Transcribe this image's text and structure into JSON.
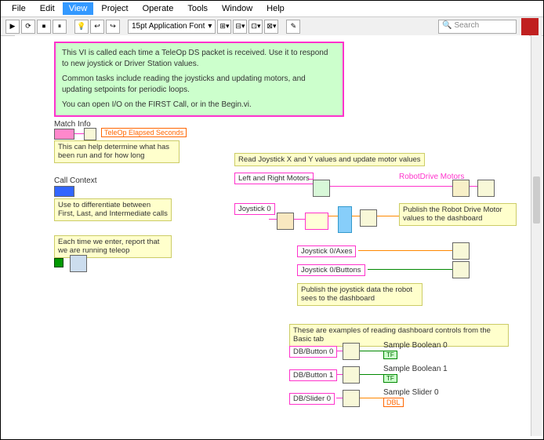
{
  "menu": {
    "file": "File",
    "edit": "Edit",
    "view": "View",
    "project": "Project",
    "operate": "Operate",
    "tools": "Tools",
    "window": "Window",
    "help": "Help"
  },
  "toolbar": {
    "font": "15pt Application Font",
    "search_placeholder": "Search"
  },
  "desc": {
    "line1": "This VI is called each time a TeleOp DS packet is received.  Use it to respond to new joystick or Driver Station values.",
    "line2": "Common tasks include reading the joysticks and updating motors, and updating setpoints for periodic loops.",
    "line3": "You can open I/O on the FIRST Call, or in the Begin.vi."
  },
  "labels": {
    "match_info": "Match Info",
    "teleop_elapsed": "TeleOp Elapsed Seconds",
    "call_context": "Call Context",
    "read_joystick": "Read Joystick X and Y values and update motor values",
    "lr_motors": "Left and Right Motors",
    "robotdrive": "RobotDrive Motors",
    "joystick0": "Joystick 0",
    "joystick0_axes": "Joystick 0/Axes",
    "joystick0_buttons": "Joystick 0/Buttons",
    "db_button0": "DB/Button 0",
    "db_button1": "DB/Button 1",
    "db_slider0": "DB/Slider 0",
    "sample_bool0": "Sample Boolean 0",
    "sample_bool1": "Sample Boolean 1",
    "sample_slider0": "Sample Slider 0",
    "dbl": "DBL",
    "tf": "TF"
  },
  "comments": {
    "match_help": "This can help determine what has been run and for how long",
    "call_ctx": "Use to differentiate between First, Last, and Intermediate calls",
    "each_time": "Each time we enter, report that we are running teleop",
    "publish_drive": "Publish the Robot Drive Motor values to the dashboard",
    "publish_joy": "Publish the joystick data the robot sees to the dashboard",
    "dash_examples": "These are examples of reading dashboard controls from the Basic tab"
  }
}
